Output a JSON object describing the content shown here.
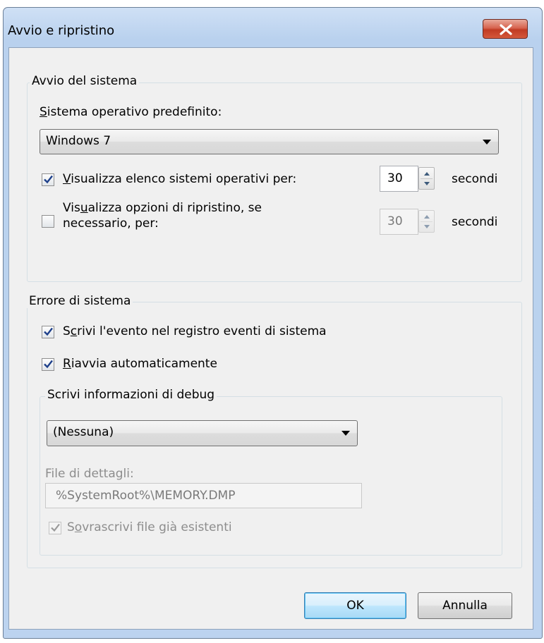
{
  "window": {
    "title": "Avvio e ripristino"
  },
  "startup": {
    "group_label": "Avvio del sistema",
    "default_os_label_underlined": "S",
    "default_os_label_rest": "istema operativo predefinito:",
    "default_os_value": "Windows 7",
    "show_os_list": {
      "checked": true,
      "label_underlined": "V",
      "label_rest": "isualizza elenco sistemi operativi per:",
      "value": "30",
      "unit": "secondi"
    },
    "show_recovery": {
      "checked": false,
      "label_line1_pre": "Vis",
      "label_line1_underlined": "u",
      "label_line1_post": "alizza opzioni di ripristino, se",
      "label_line2": "necessario, per:",
      "value": "30",
      "unit": "secondi"
    }
  },
  "failure": {
    "group_label": "Errore di sistema",
    "write_event": {
      "checked": true,
      "label_pre": "S",
      "label_underlined": "c",
      "label_post": "rivi l'evento nel registro eventi di sistema"
    },
    "auto_restart": {
      "checked": true,
      "label_underlined": "R",
      "label_rest": "iavvia automaticamente"
    },
    "debug": {
      "group_label": "Scrivi informazioni di debug",
      "select_value": "(Nessuna)",
      "dump_file_label": "File di dettagli:",
      "dump_file_value": "%SystemRoot%\\MEMORY.DMP",
      "overwrite": {
        "checked": true,
        "label_pre": "S",
        "label_underlined": "o",
        "label_post": "vrascrivi file già esistenti"
      }
    }
  },
  "buttons": {
    "ok": "OK",
    "cancel": "Annulla"
  }
}
